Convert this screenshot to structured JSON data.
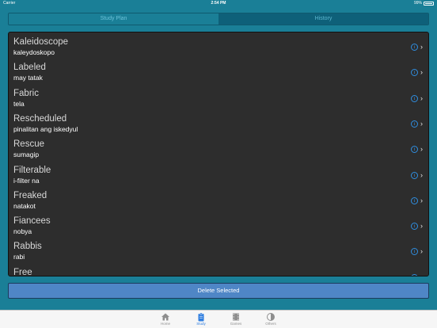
{
  "status_bar": {
    "carrier": "Carrier",
    "time": "2:54 PM",
    "battery": "99%"
  },
  "segments": [
    {
      "label": "Study Plan",
      "selected": false
    },
    {
      "label": "History",
      "selected": true
    }
  ],
  "list": {
    "items": [
      {
        "word": "Kaleidoscope",
        "translation": "kaleydoskopo"
      },
      {
        "word": "Labeled",
        "translation": "may tatak"
      },
      {
        "word": "Fabric",
        "translation": "tela"
      },
      {
        "word": "Rescheduled",
        "translation": "pinalitan ang iskedyul"
      },
      {
        "word": "Rescue",
        "translation": "sumagip"
      },
      {
        "word": "Filterable",
        "translation": "i-filter na"
      },
      {
        "word": "Freaked",
        "translation": "natakot"
      },
      {
        "word": "Fiancees",
        "translation": "nobya"
      },
      {
        "word": "Rabbis",
        "translation": "rabi"
      },
      {
        "word": "Free",
        "translation": ""
      }
    ],
    "info_glyph": "i",
    "chevron_glyph": "›"
  },
  "delete_button": {
    "label": "Delete Selected"
  },
  "tabbar": {
    "tabs": [
      {
        "label": "Home",
        "icon": "home-icon",
        "active": false
      },
      {
        "label": "Study",
        "icon": "clipboard-icon",
        "active": true
      },
      {
        "label": "Games",
        "icon": "film-icon",
        "active": false
      },
      {
        "label": "Others",
        "icon": "contrast-icon",
        "active": false
      }
    ]
  },
  "colors": {
    "background": "#1a7f97",
    "list_background": "#2d2d2d",
    "button": "#4f86c6",
    "accent": "#2f7ee0"
  }
}
